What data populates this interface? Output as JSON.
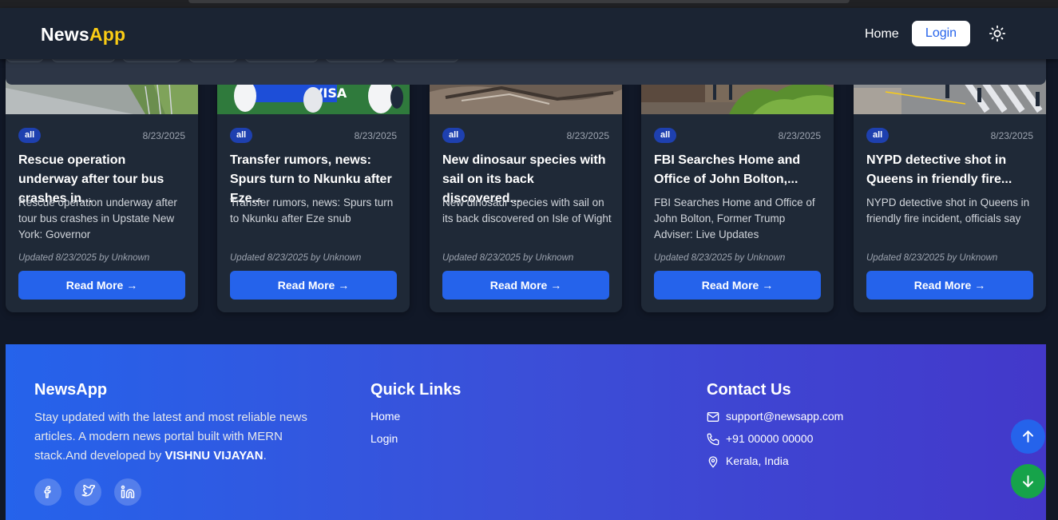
{
  "navbar": {
    "brand_main": "News",
    "brand_accent": "App",
    "home_label": "Home",
    "login_label": "Login",
    "theme_icon": "sun-icon"
  },
  "cards": [
    {
      "category": "all",
      "date": "8/23/2025",
      "title": "Rescue operation underway after tour bus crashes in...",
      "description": "Rescue operation underway after tour bus crashes in Upstate New York: Governor",
      "meta": "Updated 8/23/2025 by Unknown",
      "button": "Read More →"
    },
    {
      "category": "all",
      "date": "8/23/2025",
      "title": "Transfer rumors, news: Spurs turn to Nkunku after Eze...",
      "description": "Transfer rumors, news: Spurs turn to Nkunku after Eze snub",
      "meta": "Updated 8/23/2025 by Unknown",
      "button": "Read More →"
    },
    {
      "category": "all",
      "date": "8/23/2025",
      "title": "New dinosaur species with sail on its back discovered...",
      "description": "New dinosaur species with sail on its back discovered on Isle of Wight",
      "meta": "Updated 8/23/2025 by Unknown",
      "button": "Read More →"
    },
    {
      "category": "all",
      "date": "8/23/2025",
      "title": "FBI Searches Home and Office of John Bolton,...",
      "description": "FBI Searches Home and Office of John Bolton, Former Trump Adviser: Live Updates",
      "meta": "Updated 8/23/2025 by Unknown",
      "button": "Read More →"
    },
    {
      "category": "all",
      "date": "8/23/2025",
      "title": "NYPD detective shot in Queens in friendly fire...",
      "description": "NYPD detective shot in Queens in friendly fire incident, officials say",
      "meta": "Updated 8/23/2025 by Unknown",
      "button": "Read More →"
    }
  ],
  "footer": {
    "brand": "NewsApp",
    "about_text": "Stay updated with the latest and most reliable news articles. A modern news portal built with MERN stack.And developed by ",
    "author": "VISHNU VIJAYAN",
    "about_end": ".",
    "social_icons": [
      "facebook-icon",
      "twitter-icon",
      "linkedin-icon"
    ],
    "quick_links_heading": "Quick Links",
    "quick_links": [
      "Home",
      "Login"
    ],
    "contact_heading": "Contact Us",
    "contact": {
      "email": "support@newsapp.com",
      "phone": "+91 00000 00000",
      "location": "Kerala, India"
    }
  },
  "floating_buttons": [
    "arrow-up-icon",
    "arrow-down-icon"
  ],
  "colors": {
    "page_bg": "#111827",
    "card_bg": "#1f2937",
    "accent_blue": "#2563eb",
    "brand_yellow": "#facc15",
    "scroll_down_green": "#16a34a"
  }
}
